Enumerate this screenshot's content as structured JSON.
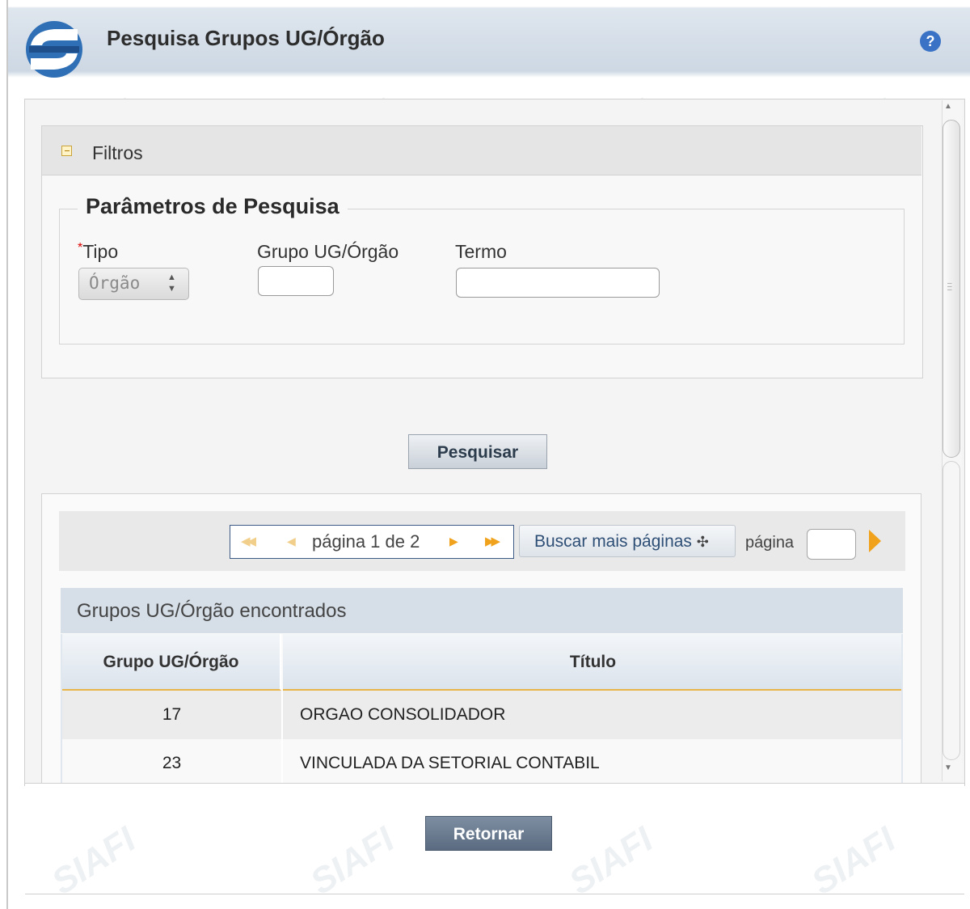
{
  "header": {
    "title": "Pesquisa Grupos UG/Órgão",
    "help_icon": "question-icon",
    "logo_icon": "siafi-logo-icon",
    "help_glyph": "?"
  },
  "filtros": {
    "label": "Filtros",
    "collapse_icon": "collapse-minus-icon",
    "legend": "Parâmetros de Pesquisa",
    "tipo": {
      "required_mark": "*",
      "label": "Tipo",
      "value": "Órgão"
    },
    "grupo": {
      "label": "Grupo UG/Órgão",
      "value": ""
    },
    "termo": {
      "label": "Termo",
      "value": ""
    }
  },
  "actions": {
    "pesquisar": "Pesquisar",
    "retornar": "Retornar"
  },
  "pager": {
    "page_text": "página 1 de 2",
    "buscar_mais": "Buscar mais páginas",
    "buscar_icon_glyph": "✣",
    "pagina_label": "página",
    "pagina_value": "",
    "current_page": 1,
    "total_pages": 2
  },
  "table": {
    "title": "Grupos UG/Órgão encontrados",
    "headers": [
      "Grupo UG/Órgão",
      "Título"
    ],
    "rows": [
      {
        "grupo": "17",
        "titulo": "ORGAO CONSOLIDADOR"
      },
      {
        "grupo": "23",
        "titulo": "VINCULADA DA SETORIAL CONTABIL"
      }
    ]
  },
  "watermark": {
    "text": "SIAFI"
  },
  "colors": {
    "header_bg": "#cdd8e4",
    "button_dark": "#5a6a80",
    "pager_arrow": "#f0a21c",
    "required": "#dd0000",
    "help_icon": "#3a73c6"
  }
}
